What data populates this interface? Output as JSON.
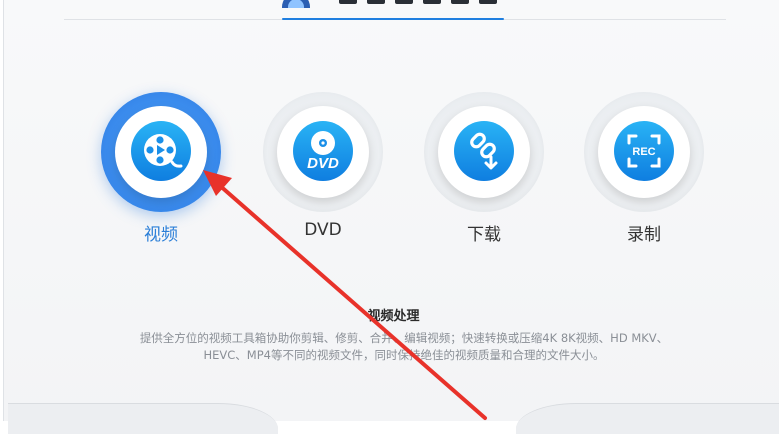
{
  "modes": [
    {
      "label": "视频",
      "icon": "film-reel-icon",
      "active": true
    },
    {
      "label": "DVD",
      "icon": "dvd-icon",
      "active": false
    },
    {
      "label": "下载",
      "icon": "download-link-icon",
      "active": false
    },
    {
      "label": "录制",
      "icon": "rec-icon",
      "active": false
    }
  ],
  "description": {
    "title": "视频处理",
    "line1": "提供全方位的视频工具箱协助你剪辑、修剪、合并、编辑视频；快速转换或压缩4K 8K视频、HD MKV、",
    "line2": "HEVC、MP4等不同的视频文件，同时保持绝佳的视频质量和合理的文件大小。"
  },
  "dvd_icon_text": "DVD",
  "rec_icon_text": "REC",
  "colors": {
    "accent": "#2b7fd8",
    "arrow": "#e8322a",
    "icon_blue": "#1a8fe8"
  }
}
